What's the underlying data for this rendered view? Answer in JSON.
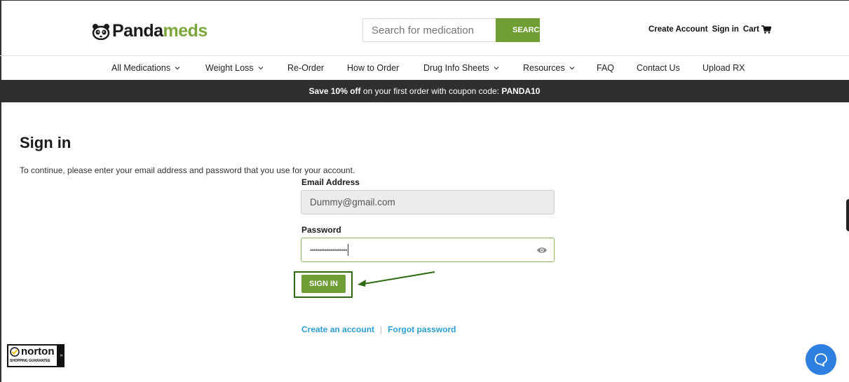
{
  "header": {
    "logo_text_a": "Panda",
    "logo_text_b": "meds",
    "search_placeholder": "Search for medication",
    "search_button": "SEARCH",
    "create_account": "Create Account",
    "sign_in": "Sign in",
    "cart": "Cart",
    "brand_color": "#7aa63a"
  },
  "nav": {
    "items": [
      {
        "label": "All Medications",
        "dropdown": true
      },
      {
        "label": "Weight Loss",
        "dropdown": true
      },
      {
        "label": "Re-Order",
        "dropdown": false
      },
      {
        "label": "How to Order",
        "dropdown": false
      },
      {
        "label": "Drug Info Sheets",
        "dropdown": true
      },
      {
        "label": "Resources",
        "dropdown": true
      },
      {
        "label": "FAQ",
        "dropdown": false
      },
      {
        "label": "Contact Us",
        "dropdown": false
      },
      {
        "label": "Upload RX",
        "dropdown": false
      }
    ]
  },
  "promo": {
    "bold_prefix": "Save 10% off",
    "middle": " on your first order with coupon code: ",
    "code": "PANDA10"
  },
  "signin": {
    "title": "Sign in",
    "intro": "To continue, please enter your email address and password that you use for your account.",
    "email_label": "Email Address",
    "email_value": "Dummy@gmail.com",
    "password_label": "Password",
    "password_value": "••••••••••••••••••••",
    "button": "SIGN IN",
    "create_link": "Create an account",
    "separator": "|",
    "forgot_link": "Forgot password"
  },
  "norton": {
    "brand": "norton",
    "sub": "SHOPPING GUARANTEE",
    "tab": "»"
  },
  "colors": {
    "accent_green": "#6e9e34",
    "promo_bg": "#2f2f2f",
    "link_blue": "#2a9fd6",
    "chat_blue": "#2f7fe0",
    "highlight_box": "#2c6b0f"
  }
}
